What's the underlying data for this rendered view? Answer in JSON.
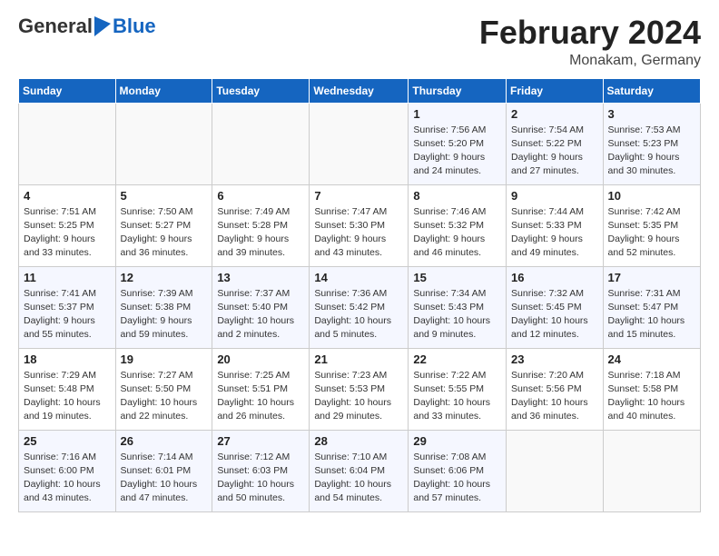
{
  "logo": {
    "general": "General",
    "blue": "Blue"
  },
  "title": "February 2024",
  "subtitle": "Monakam, Germany",
  "days_of_week": [
    "Sunday",
    "Monday",
    "Tuesday",
    "Wednesday",
    "Thursday",
    "Friday",
    "Saturday"
  ],
  "weeks": [
    [
      {
        "day": "",
        "info": ""
      },
      {
        "day": "",
        "info": ""
      },
      {
        "day": "",
        "info": ""
      },
      {
        "day": "",
        "info": ""
      },
      {
        "day": "1",
        "info": "Sunrise: 7:56 AM\nSunset: 5:20 PM\nDaylight: 9 hours and 24 minutes."
      },
      {
        "day": "2",
        "info": "Sunrise: 7:54 AM\nSunset: 5:22 PM\nDaylight: 9 hours and 27 minutes."
      },
      {
        "day": "3",
        "info": "Sunrise: 7:53 AM\nSunset: 5:23 PM\nDaylight: 9 hours and 30 minutes."
      }
    ],
    [
      {
        "day": "4",
        "info": "Sunrise: 7:51 AM\nSunset: 5:25 PM\nDaylight: 9 hours and 33 minutes."
      },
      {
        "day": "5",
        "info": "Sunrise: 7:50 AM\nSunset: 5:27 PM\nDaylight: 9 hours and 36 minutes."
      },
      {
        "day": "6",
        "info": "Sunrise: 7:49 AM\nSunset: 5:28 PM\nDaylight: 9 hours and 39 minutes."
      },
      {
        "day": "7",
        "info": "Sunrise: 7:47 AM\nSunset: 5:30 PM\nDaylight: 9 hours and 43 minutes."
      },
      {
        "day": "8",
        "info": "Sunrise: 7:46 AM\nSunset: 5:32 PM\nDaylight: 9 hours and 46 minutes."
      },
      {
        "day": "9",
        "info": "Sunrise: 7:44 AM\nSunset: 5:33 PM\nDaylight: 9 hours and 49 minutes."
      },
      {
        "day": "10",
        "info": "Sunrise: 7:42 AM\nSunset: 5:35 PM\nDaylight: 9 hours and 52 minutes."
      }
    ],
    [
      {
        "day": "11",
        "info": "Sunrise: 7:41 AM\nSunset: 5:37 PM\nDaylight: 9 hours and 55 minutes."
      },
      {
        "day": "12",
        "info": "Sunrise: 7:39 AM\nSunset: 5:38 PM\nDaylight: 9 hours and 59 minutes."
      },
      {
        "day": "13",
        "info": "Sunrise: 7:37 AM\nSunset: 5:40 PM\nDaylight: 10 hours and 2 minutes."
      },
      {
        "day": "14",
        "info": "Sunrise: 7:36 AM\nSunset: 5:42 PM\nDaylight: 10 hours and 5 minutes."
      },
      {
        "day": "15",
        "info": "Sunrise: 7:34 AM\nSunset: 5:43 PM\nDaylight: 10 hours and 9 minutes."
      },
      {
        "day": "16",
        "info": "Sunrise: 7:32 AM\nSunset: 5:45 PM\nDaylight: 10 hours and 12 minutes."
      },
      {
        "day": "17",
        "info": "Sunrise: 7:31 AM\nSunset: 5:47 PM\nDaylight: 10 hours and 15 minutes."
      }
    ],
    [
      {
        "day": "18",
        "info": "Sunrise: 7:29 AM\nSunset: 5:48 PM\nDaylight: 10 hours and 19 minutes."
      },
      {
        "day": "19",
        "info": "Sunrise: 7:27 AM\nSunset: 5:50 PM\nDaylight: 10 hours and 22 minutes."
      },
      {
        "day": "20",
        "info": "Sunrise: 7:25 AM\nSunset: 5:51 PM\nDaylight: 10 hours and 26 minutes."
      },
      {
        "day": "21",
        "info": "Sunrise: 7:23 AM\nSunset: 5:53 PM\nDaylight: 10 hours and 29 minutes."
      },
      {
        "day": "22",
        "info": "Sunrise: 7:22 AM\nSunset: 5:55 PM\nDaylight: 10 hours and 33 minutes."
      },
      {
        "day": "23",
        "info": "Sunrise: 7:20 AM\nSunset: 5:56 PM\nDaylight: 10 hours and 36 minutes."
      },
      {
        "day": "24",
        "info": "Sunrise: 7:18 AM\nSunset: 5:58 PM\nDaylight: 10 hours and 40 minutes."
      }
    ],
    [
      {
        "day": "25",
        "info": "Sunrise: 7:16 AM\nSunset: 6:00 PM\nDaylight: 10 hours and 43 minutes."
      },
      {
        "day": "26",
        "info": "Sunrise: 7:14 AM\nSunset: 6:01 PM\nDaylight: 10 hours and 47 minutes."
      },
      {
        "day": "27",
        "info": "Sunrise: 7:12 AM\nSunset: 6:03 PM\nDaylight: 10 hours and 50 minutes."
      },
      {
        "day": "28",
        "info": "Sunrise: 7:10 AM\nSunset: 6:04 PM\nDaylight: 10 hours and 54 minutes."
      },
      {
        "day": "29",
        "info": "Sunrise: 7:08 AM\nSunset: 6:06 PM\nDaylight: 10 hours and 57 minutes."
      },
      {
        "day": "",
        "info": ""
      },
      {
        "day": "",
        "info": ""
      }
    ]
  ]
}
